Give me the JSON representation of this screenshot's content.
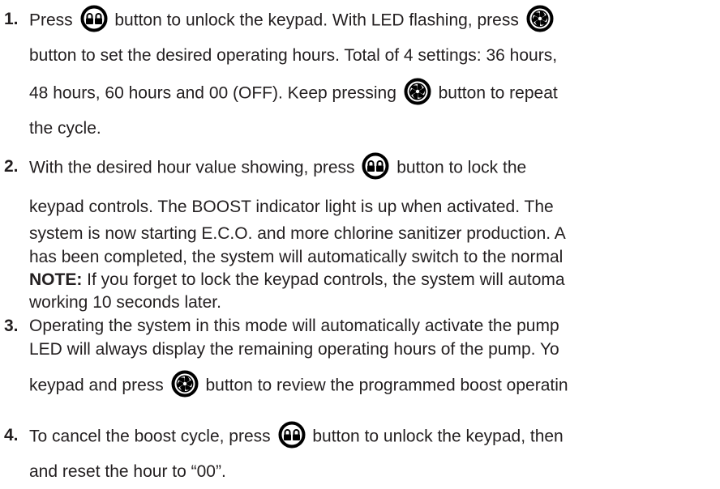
{
  "steps": [
    {
      "number": "1.",
      "lines": [
        {
          "before": "Press",
          "icon": "lock-icon",
          "after": "button to unlock the keypad. With LED flashing, press"
        },
        {
          "text": "button to set the desired operating hours. Total of 4 settings: 36 hours,"
        },
        {
          "before": "48 hours, 60 hours and 00 (OFF). Keep pressing",
          "icon": "boost-icon",
          "after": "button to repeat"
        },
        {
          "text": "the cycle."
        }
      ],
      "trailing_icon": "boost-icon"
    },
    {
      "number": "2.",
      "lines": [
        {
          "before": "With the desired hour value showing, press",
          "icon": "lock-icon",
          "after": "button to lock the"
        },
        {
          "text": "keypad controls. The BOOST indicator light is up when activated. The"
        },
        {
          "text": "system is now starting E.C.O. and more chlorine sanitizer production. A"
        },
        {
          "text": "has been completed, the system will automatically switch to the normal"
        },
        {
          "note_label": "NOTE:",
          "text": " If you forget to lock the keypad controls, the system will automa"
        },
        {
          "text": "working 10 seconds later."
        }
      ]
    },
    {
      "number": "3.",
      "lines": [
        {
          "text": "Operating the system in this mode will automatically activate the pump"
        },
        {
          "text": "LED will always display the remaining operating hours of the pump. Yo"
        },
        {
          "before": "keypad and press",
          "icon": "boost-icon",
          "after": "button to review the programmed boost operatin"
        }
      ]
    },
    {
      "number": "4.",
      "lines": [
        {
          "before": "To cancel the boost cycle, press",
          "icon": "lock-icon",
          "after": "button to unlock the keypad, then"
        },
        {
          "text": "and reset the hour to “00”."
        }
      ]
    }
  ]
}
